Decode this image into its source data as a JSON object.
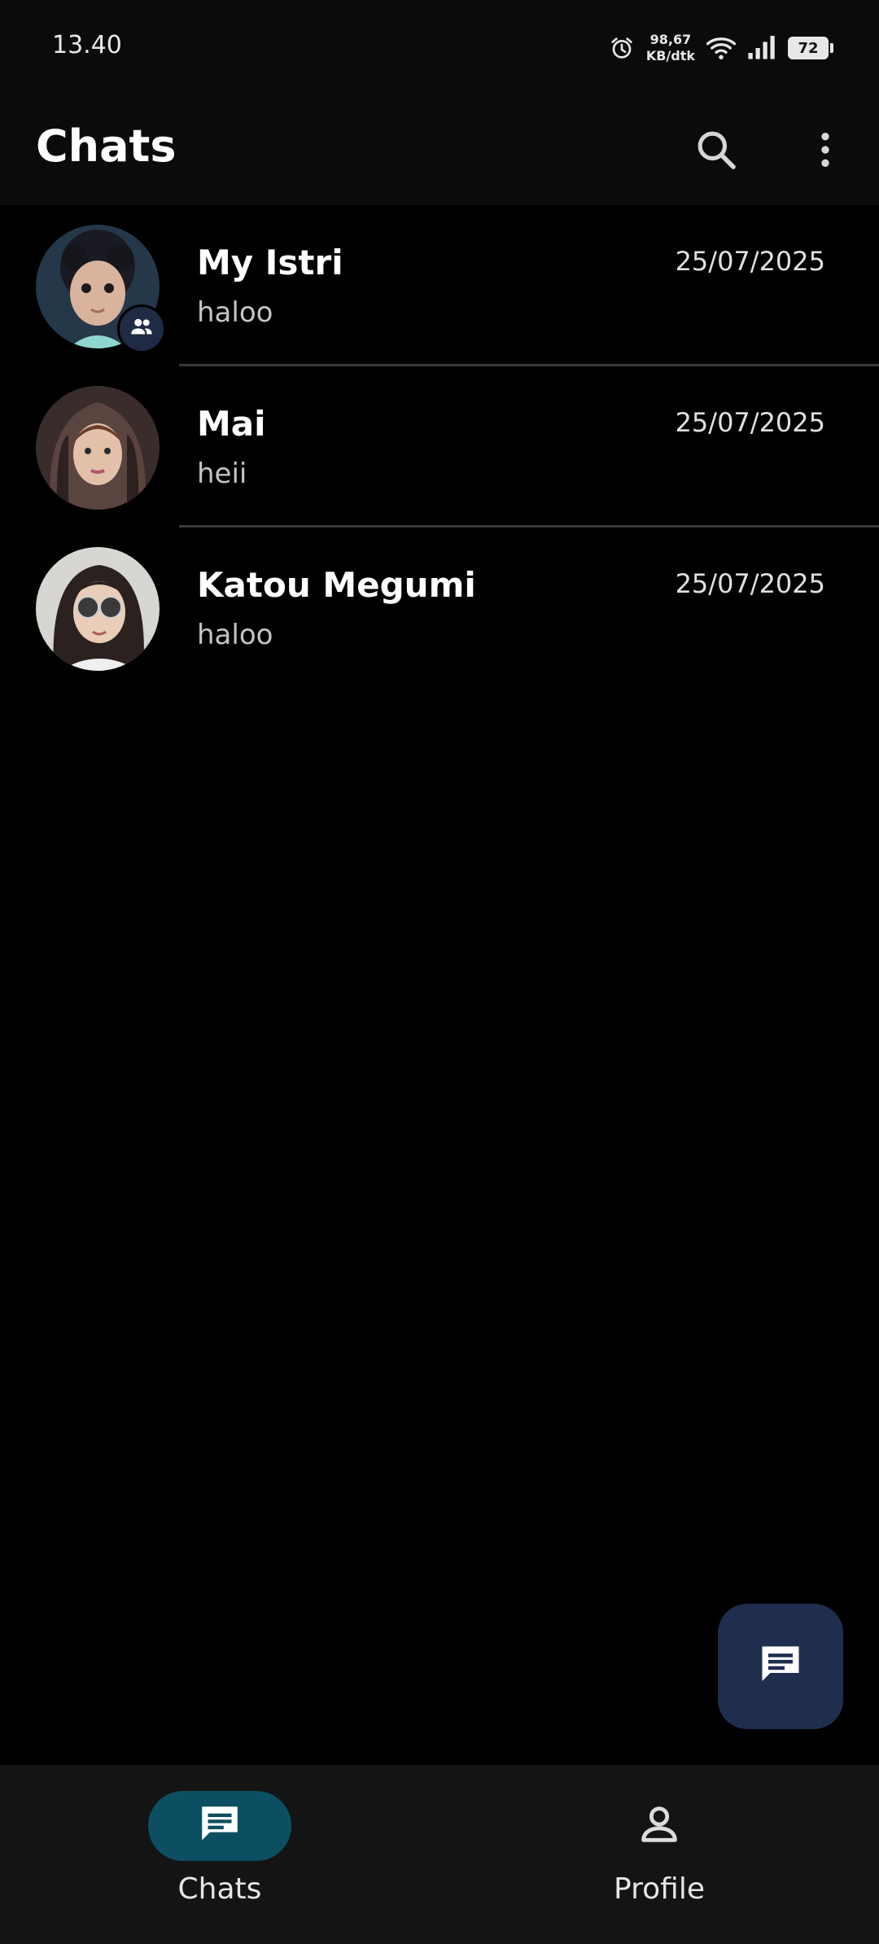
{
  "status_bar": {
    "time": "13.40",
    "net_speed_value": "98,67",
    "net_speed_unit": "KB/dtk",
    "battery": "72"
  },
  "app_bar": {
    "title": "Chats",
    "search_icon": "search-icon",
    "more_icon": "more-vert-icon"
  },
  "chats": [
    {
      "name": "My Istri",
      "preview": "haloo",
      "date": "25/07/2025",
      "group": true
    },
    {
      "name": "Mai",
      "preview": "heii",
      "date": "25/07/2025",
      "group": false
    },
    {
      "name": "Katou Megumi",
      "preview": "haloo",
      "date": "25/07/2025",
      "group": false
    }
  ],
  "fab": {
    "icon": "new-chat-icon"
  },
  "bottom_nav": {
    "items": [
      {
        "label": "Chats",
        "icon": "chat-icon",
        "active": true
      },
      {
        "label": "Profile",
        "icon": "person-icon",
        "active": false
      }
    ]
  },
  "colors": {
    "background": "#000000",
    "app_bar": "#0b0b0b",
    "nav_bar": "#141414",
    "active_pill": "#0d4f62",
    "fab": "#1f2e4e"
  }
}
